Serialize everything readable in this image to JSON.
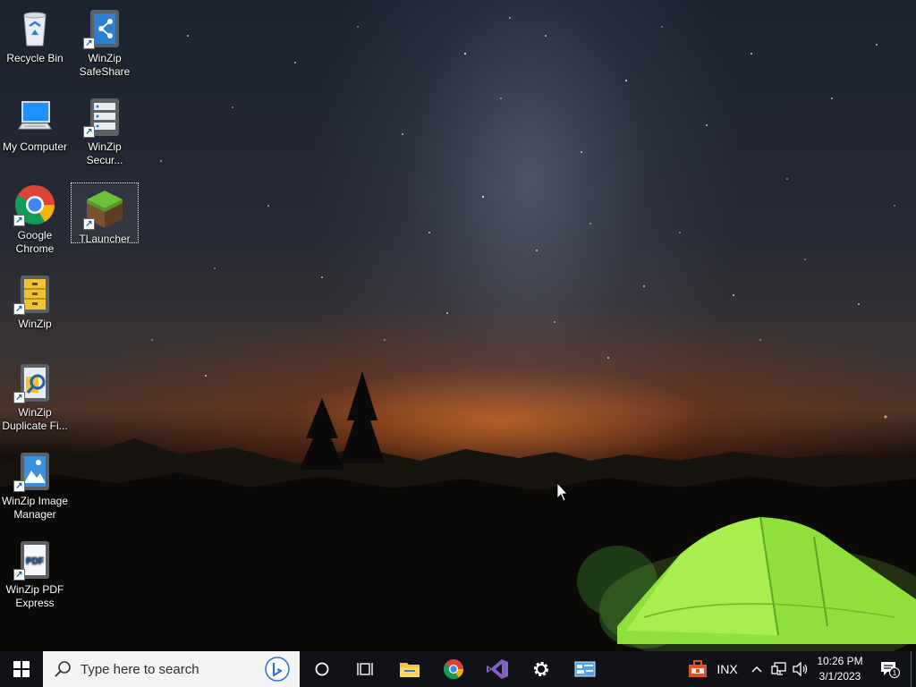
{
  "desktop": {
    "icons": [
      {
        "id": "recycle-bin",
        "label": "Recycle Bin",
        "icon": "recycle-bin-icon",
        "shortcut": false
      },
      {
        "id": "winzip-safeshare",
        "label": "WinZip SafeShare",
        "icon": "winzip-safeshare-icon",
        "shortcut": true
      },
      {
        "id": "my-computer",
        "label": "My Computer",
        "icon": "computer-icon",
        "shortcut": false
      },
      {
        "id": "winzip-secure",
        "label": "WinZip Secur...",
        "icon": "winzip-secure-backup-icon",
        "shortcut": true
      },
      {
        "id": "google-chrome",
        "label": "Google Chrome",
        "icon": "chrome-icon",
        "shortcut": true
      },
      {
        "id": "tlauncher",
        "label": "TLauncher",
        "icon": "tlauncher-icon",
        "shortcut": true,
        "selected": true
      },
      {
        "id": "winzip",
        "label": "WinZip",
        "icon": "winzip-icon",
        "shortcut": true
      },
      {
        "id": "winzip-duplicate",
        "label": "WinZip Duplicate Fi...",
        "icon": "winzip-duplicate-finder-icon",
        "shortcut": true
      },
      {
        "id": "winzip-image-manager",
        "label": "WinZip Image Manager",
        "icon": "winzip-image-manager-icon",
        "shortcut": true
      },
      {
        "id": "winzip-pdf-express",
        "label": "WinZip PDF Express",
        "icon": "winzip-pdf-express-icon",
        "shortcut": true
      }
    ],
    "pdf_badge_text": "PDF"
  },
  "taskbar": {
    "start_icon": "windows-start-icon",
    "search_placeholder": "Type here to search",
    "pinned": [
      {
        "name": "cortana",
        "icon": "cortana-circle-icon"
      },
      {
        "name": "task-view",
        "icon": "task-view-icon"
      },
      {
        "name": "file-explorer",
        "icon": "folder-icon"
      },
      {
        "name": "chrome",
        "icon": "chrome-icon"
      },
      {
        "name": "visual-studio",
        "icon": "visual-studio-icon"
      },
      {
        "name": "settings",
        "icon": "gear-icon"
      },
      {
        "name": "control-panel",
        "icon": "control-panel-icon"
      }
    ],
    "tray": {
      "language": "INX",
      "time": "10:26 PM",
      "date": "3/1/2023",
      "notification_count": "1"
    }
  },
  "colors": {
    "taskbar_bg": "#101218",
    "search_bg": "#f3f3f3",
    "tent_green": "#8fe03a"
  }
}
